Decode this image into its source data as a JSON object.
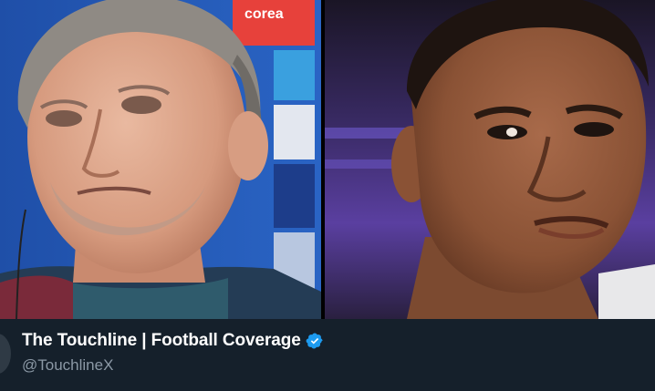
{
  "media": {
    "left_photo": "photo-coach-press-conference",
    "right_photo": "photo-player-portrait",
    "banner_text": "corea"
  },
  "author": {
    "display_name": "The Touchline | Football Coverage",
    "handle": "@TouchlineX",
    "verified_icon": "verified-badge-icon",
    "verified_color": "#1d9bf0"
  },
  "colors": {
    "background": "#15202b",
    "name_text": "#ffffff",
    "handle_text": "#8b98a5"
  }
}
